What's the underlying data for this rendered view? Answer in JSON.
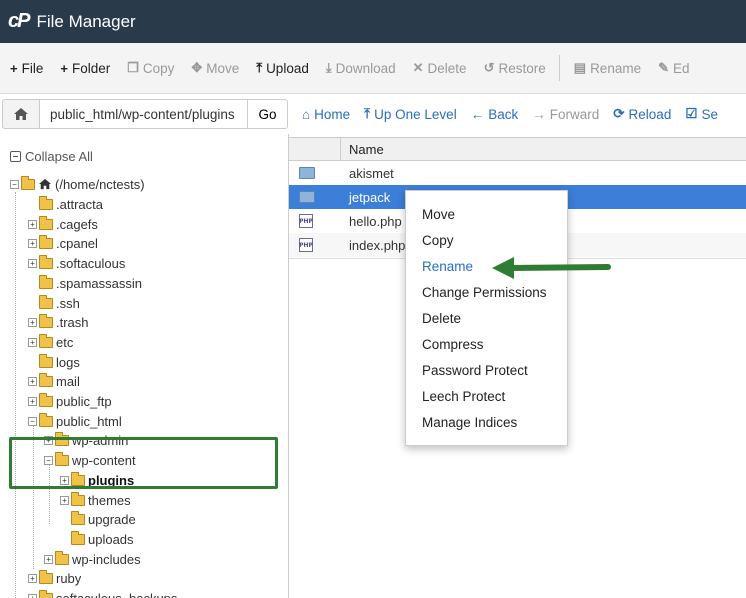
{
  "app": {
    "logo": "cP",
    "title": "File Manager"
  },
  "toolbar": {
    "buttons": [
      {
        "icon": "+",
        "label": "File",
        "enabled": true
      },
      {
        "icon": "+",
        "label": "Folder",
        "enabled": true
      },
      {
        "icon": "❐",
        "label": "Copy",
        "enabled": false
      },
      {
        "icon": "✥",
        "label": "Move",
        "enabled": false
      },
      {
        "icon": "⤒",
        "label": "Upload",
        "enabled": true
      },
      {
        "icon": "⤓",
        "label": "Download",
        "enabled": false
      },
      {
        "icon": "✕",
        "label": "Delete",
        "enabled": false
      },
      {
        "icon": "↺",
        "label": "Restore",
        "enabled": false
      },
      {
        "icon": "▤",
        "label": "Rename",
        "enabled": false
      },
      {
        "icon": "✎",
        "label": "Ed",
        "enabled": false
      }
    ]
  },
  "navbar": {
    "path": "public_html/wp-content/plugins",
    "go_label": "Go",
    "links": [
      {
        "icon": "⌂",
        "label": "Home",
        "enabled": true
      },
      {
        "icon": "⤒",
        "label": "Up One Level",
        "enabled": true
      },
      {
        "icon": "←",
        "label": "Back",
        "enabled": true
      },
      {
        "icon": "→",
        "label": "Forward",
        "enabled": false
      },
      {
        "icon": "⟳",
        "label": "Reload",
        "enabled": true
      },
      {
        "icon": "☑",
        "label": "Se",
        "enabled": true
      }
    ]
  },
  "tree": {
    "collapse_all": "Collapse All",
    "root": "(/home/nctests)",
    "items": [
      {
        "label": ".attracta",
        "depth": 1,
        "toggle": ""
      },
      {
        "label": ".cagefs",
        "depth": 1,
        "toggle": "+"
      },
      {
        "label": ".cpanel",
        "depth": 1,
        "toggle": "+"
      },
      {
        "label": ".softaculous",
        "depth": 1,
        "toggle": "+"
      },
      {
        "label": ".spamassassin",
        "depth": 1,
        "toggle": ""
      },
      {
        "label": ".ssh",
        "depth": 1,
        "toggle": ""
      },
      {
        "label": ".trash",
        "depth": 1,
        "toggle": "+"
      },
      {
        "label": "etc",
        "depth": 1,
        "toggle": "+"
      },
      {
        "label": "logs",
        "depth": 1,
        "toggle": ""
      },
      {
        "label": "mail",
        "depth": 1,
        "toggle": "+"
      },
      {
        "label": "public_ftp",
        "depth": 1,
        "toggle": "+"
      },
      {
        "label": "public_html",
        "depth": 1,
        "toggle": "−"
      },
      {
        "label": "wp-admin",
        "depth": 2,
        "toggle": "+"
      },
      {
        "label": "wp-content",
        "depth": 2,
        "toggle": "−"
      },
      {
        "label": "plugins",
        "depth": 3,
        "toggle": "+",
        "bold": true
      },
      {
        "label": "themes",
        "depth": 3,
        "toggle": "+"
      },
      {
        "label": "upgrade",
        "depth": 3,
        "toggle": ""
      },
      {
        "label": "uploads",
        "depth": 3,
        "toggle": ""
      },
      {
        "label": "wp-includes",
        "depth": 2,
        "toggle": "+"
      },
      {
        "label": "ruby",
        "depth": 1,
        "toggle": "+"
      },
      {
        "label": "softaculous_backups",
        "depth": 1,
        "toggle": "+"
      }
    ]
  },
  "files": {
    "header_name": "Name",
    "rows": [
      {
        "name": "akismet",
        "type": "dir",
        "selected": false
      },
      {
        "name": "jetpack",
        "type": "dir",
        "selected": true
      },
      {
        "name": "hello.php",
        "type": "php",
        "selected": false
      },
      {
        "name": "index.php",
        "type": "php",
        "selected": false
      }
    ],
    "php_icon_text": "PHP"
  },
  "context_menu": {
    "items": [
      {
        "label": "Move",
        "active": false
      },
      {
        "label": "Copy",
        "active": false
      },
      {
        "label": "Rename",
        "active": true
      },
      {
        "label": "Change Permissions",
        "active": false
      },
      {
        "label": "Delete",
        "active": false
      },
      {
        "label": "Compress",
        "active": false
      },
      {
        "label": "Password Protect",
        "active": false
      },
      {
        "label": "Leech Protect",
        "active": false
      },
      {
        "label": "Manage Indices",
        "active": false
      }
    ]
  },
  "colors": {
    "titlebar": "#293a4a",
    "link": "#2a6ebb",
    "selected_row": "#3c7fd9",
    "highlight_green": "#2f7d32"
  }
}
